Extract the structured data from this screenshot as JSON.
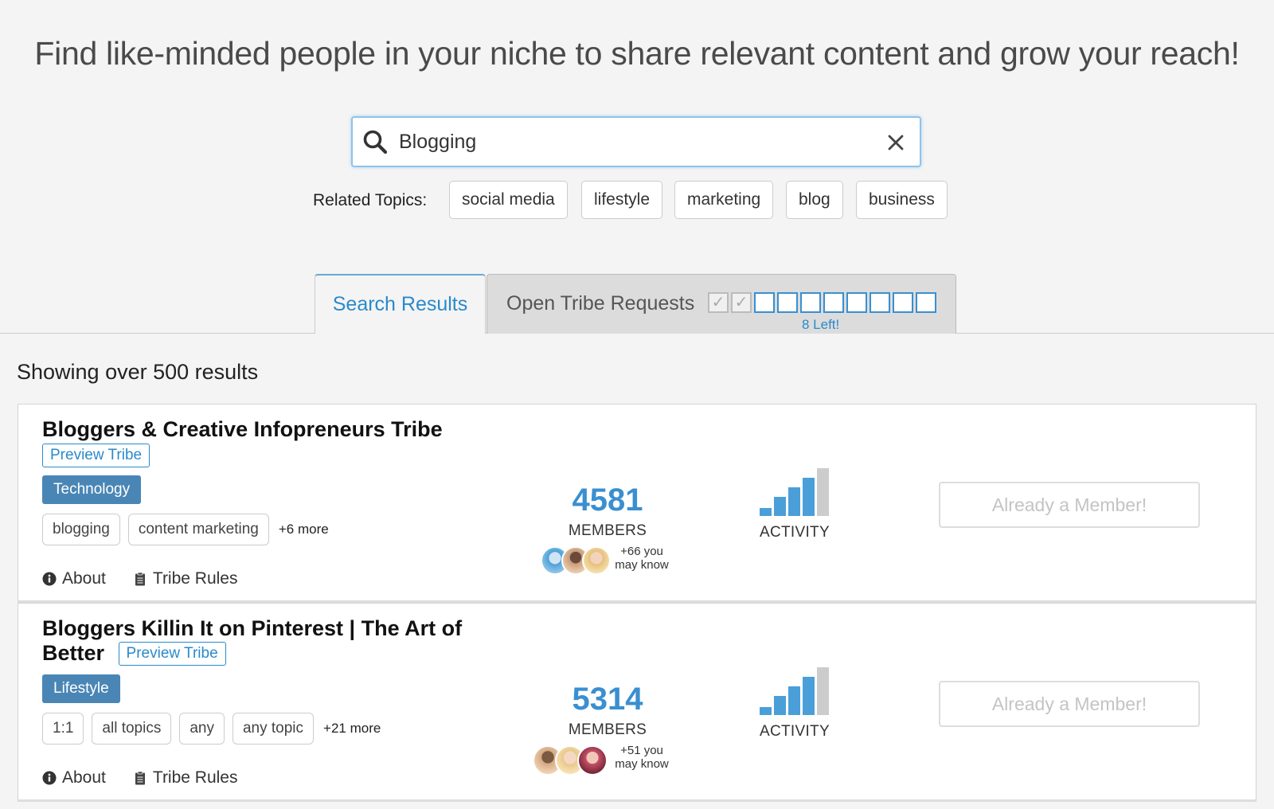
{
  "headline": "Find like-minded people in your niche to share relevant content and grow your reach!",
  "search": {
    "value": "Blogging",
    "placeholder": ""
  },
  "related": {
    "label": "Related Topics:",
    "topics": [
      "social media",
      "lifestyle",
      "marketing",
      "blog",
      "business"
    ]
  },
  "tabs": {
    "search_results": "Search Results",
    "open_requests": "Open Tribe Requests",
    "requests_used": 2,
    "requests_total": 10,
    "requests_left": "8 Left!"
  },
  "results_count": "Showing over 500 results",
  "colors": {
    "accent": "#2a8acb",
    "badge": "#4a86b5",
    "bar": "#4a9fd8",
    "bar_inactive": "#cccccc"
  },
  "cards": [
    {
      "title": "Bloggers & Creative Infopreneurs Tribe",
      "preview": "Preview Tribe",
      "category": "Technology",
      "tags": [
        "blogging",
        "content marketing"
      ],
      "more": "+6 more",
      "about": "About",
      "rules": "Tribe Rules",
      "members": "4581",
      "members_label": "MEMBERS",
      "know_line1": "+66 you",
      "know_line2": "may know",
      "activity_label": "ACTIVITY",
      "activity_level": 4,
      "activity_max": 5,
      "button": "Already a Member!"
    },
    {
      "title": "Bloggers Killin It on Pinterest | The Art of Better",
      "preview": "Preview Tribe",
      "category": "Lifestyle",
      "tags": [
        "1:1",
        "all topics",
        "any",
        "any topic"
      ],
      "more": "+21 more",
      "about": "About",
      "rules": "Tribe Rules",
      "members": "5314",
      "members_label": "MEMBERS",
      "know_line1": "+51 you",
      "know_line2": "may know",
      "activity_label": "ACTIVITY",
      "activity_level": 4,
      "activity_max": 5,
      "button": "Already a Member!"
    }
  ]
}
